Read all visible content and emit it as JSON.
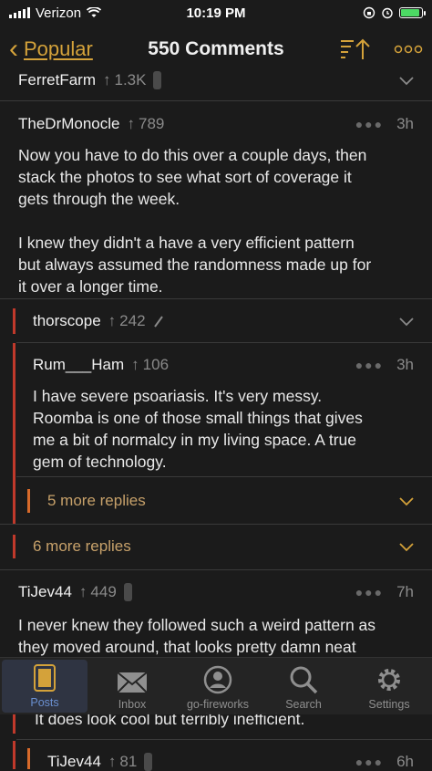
{
  "status": {
    "carrier": "Verizon",
    "time": "10:19 PM"
  },
  "nav": {
    "back_label": "Popular",
    "title": "550 Comments"
  },
  "comments": [
    {
      "author": "FerretFarm",
      "score": "1.3K"
    },
    {
      "author": "TheDrMonocle",
      "score": "789",
      "age": "3h",
      "lines": [
        "Now you have to do this over a couple days, then",
        "stack the photos to see what sort of coverage it",
        "gets through the week.",
        "",
        "I knew they didn't a have a very efficient pattern",
        "but always assumed the randomness made up for",
        "it over a longer time."
      ]
    },
    {
      "author": "thorscope",
      "score": "242"
    },
    {
      "author": "Rum___Ham",
      "score": "106",
      "age": "3h",
      "lines": [
        "I have severe psoariasis. It's very messy.",
        "Roomba is one of those small things that gives",
        "me a bit of normalcy in my living space. A true",
        "gem of technology."
      ]
    },
    {
      "more": "5 more replies"
    },
    {
      "more": "6 more replies"
    },
    {
      "author": "TiJev44",
      "score": "449",
      "age": "7h",
      "lines": [
        "I never knew they followed such a weird pattern as",
        "they moved around, that looks pretty damn neat"
      ]
    },
    {
      "partial": "It does look cool but terribly inefficient."
    },
    {
      "author": "TiJev44",
      "score": "81",
      "age": "6h"
    }
  ],
  "tabs": [
    {
      "label": "Posts",
      "icon": "posts-icon"
    },
    {
      "label": "Inbox",
      "icon": "inbox-icon"
    },
    {
      "label": "go-fireworks",
      "icon": "profile-icon"
    },
    {
      "label": "Search",
      "icon": "search-icon"
    },
    {
      "label": "Settings",
      "icon": "settings-icon"
    }
  ],
  "colors": {
    "accent": "#d4a23a",
    "background": "#1b1b1b",
    "thread_bar": "#c0392b",
    "thread_bar_nested": "#d86a2a"
  }
}
